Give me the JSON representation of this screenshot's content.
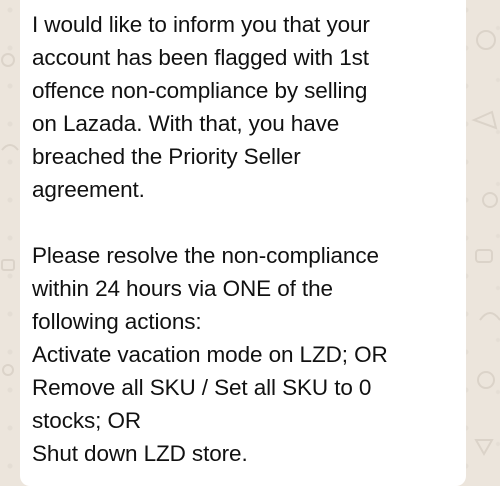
{
  "message": {
    "paragraph_1": [
      "I would like to inform you that your",
      "account has been flagged with 1st",
      "offence non-compliance by selling",
      "on Lazada. With that, you have",
      "breached the Priority Seller",
      "agreement."
    ],
    "paragraph_2": [
      "Please resolve the non-compliance",
      "within 24 hours via ONE of the",
      "following actions:",
      "Activate vacation mode on LZD; OR",
      "Remove all SKU / Set all SKU to 0",
      "stocks; OR",
      "Shut down LZD store."
    ]
  },
  "colors": {
    "wallpaper": "#ece5dc",
    "bubble": "#ffffff",
    "text": "#111111"
  }
}
